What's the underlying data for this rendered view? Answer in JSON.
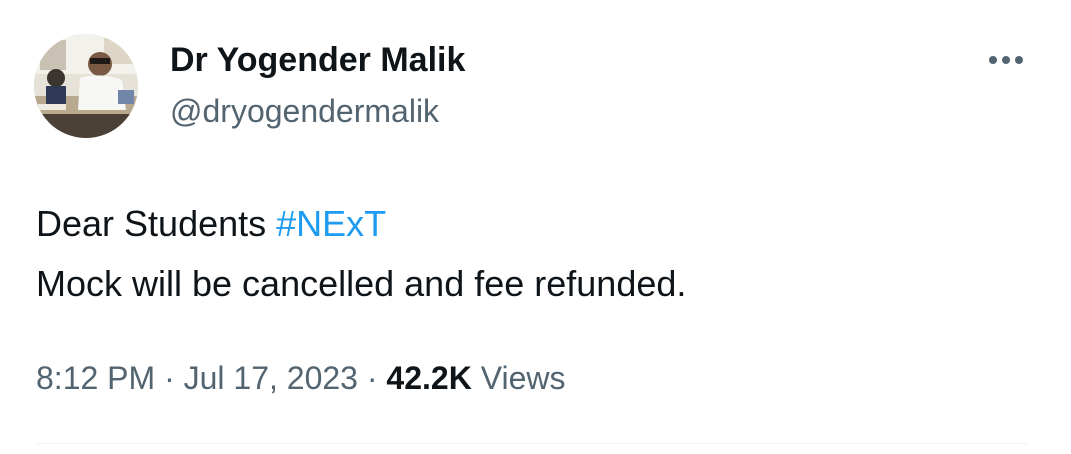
{
  "author": {
    "name": "Dr Yogender Malik",
    "handle": "@dryogendermalik",
    "avatar_icon": "profile-photo"
  },
  "more_icon": "more-options-icon",
  "tweet": {
    "line1_text": "Dear Students ",
    "hashtag": "#NExT",
    "line2_text": "Mock will be cancelled and fee refunded."
  },
  "meta": {
    "time": "8:12 PM",
    "separator1": " · ",
    "date": "Jul 17, 2023",
    "separator2": " · ",
    "views_count": "42.2K",
    "views_label": " Views"
  },
  "colors": {
    "text": "#0f1419",
    "secondary": "#536471",
    "link": "#1d9bf0",
    "divider": "#eff3f4"
  }
}
